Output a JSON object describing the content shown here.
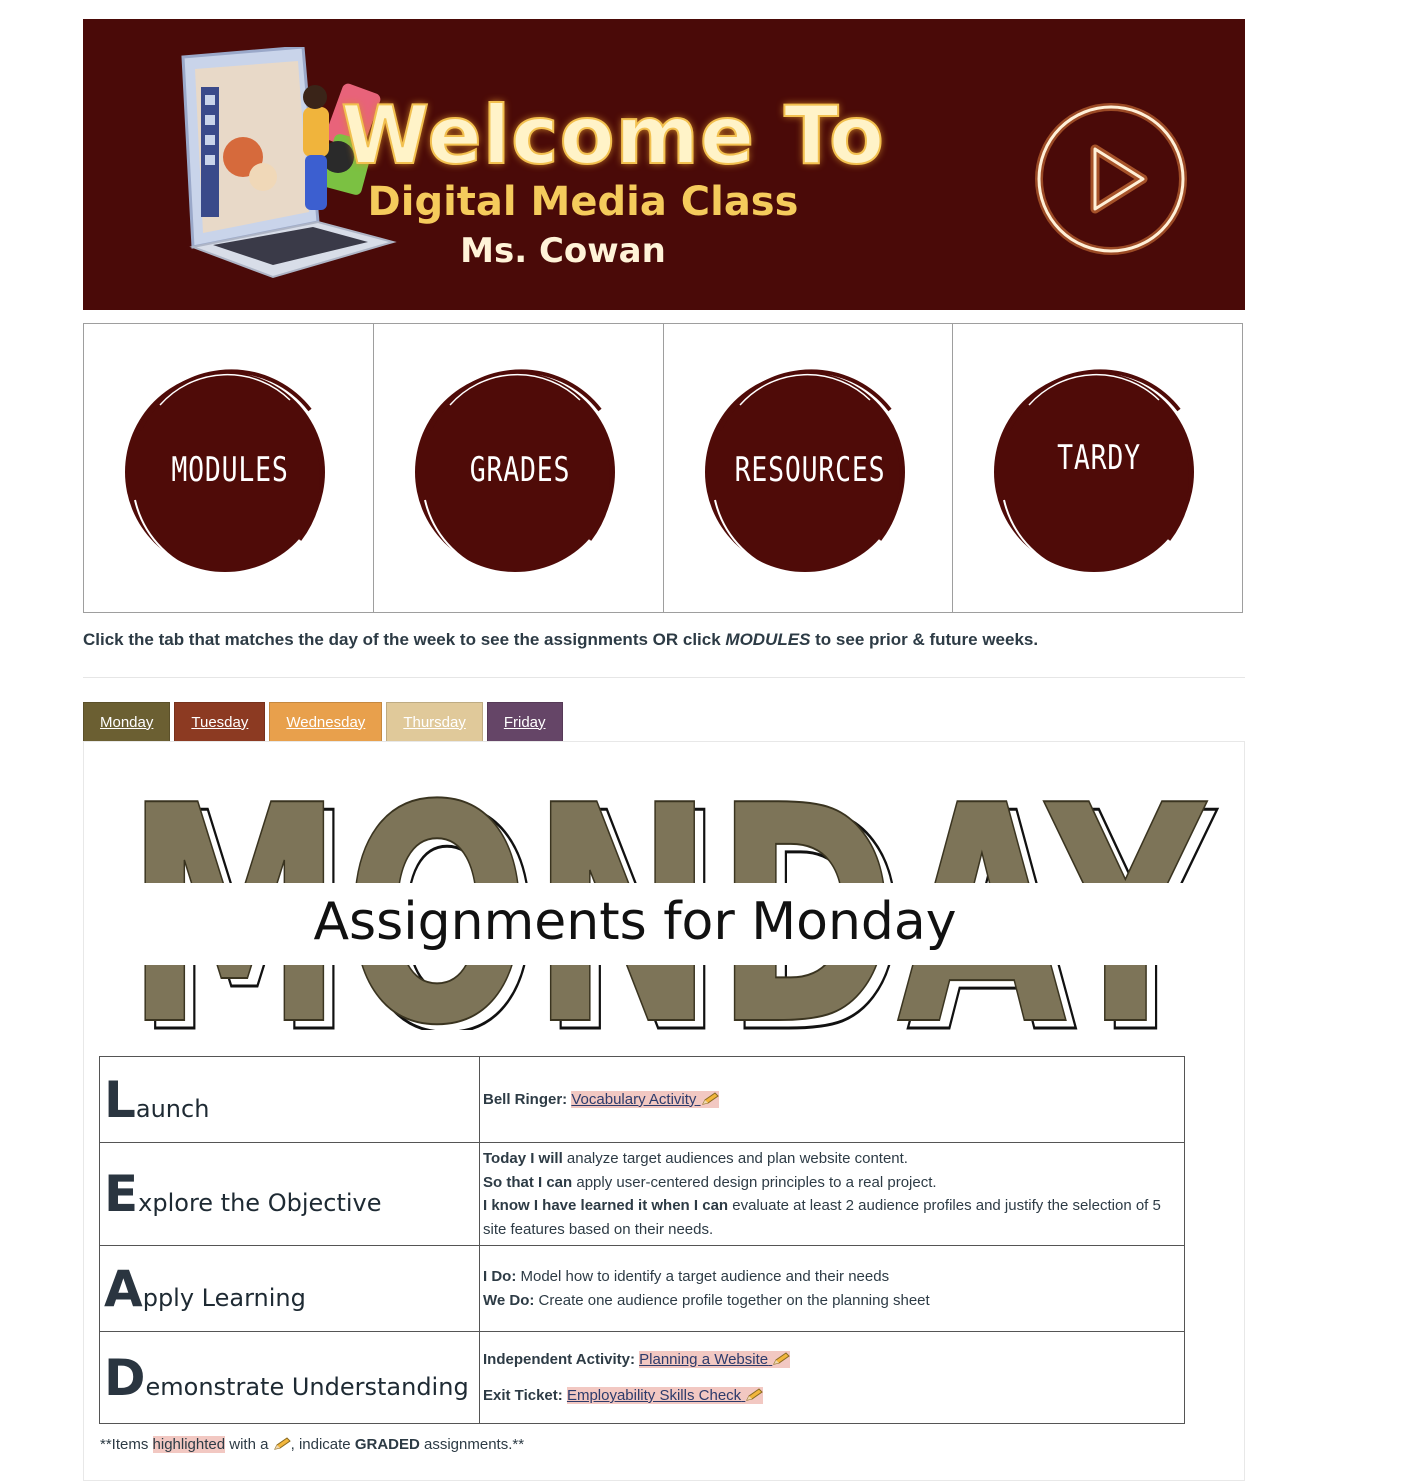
{
  "banner": {
    "title": "Welcome To",
    "class_name": "Digital Media Class",
    "teacher": "Ms. Cowan"
  },
  "nav": {
    "buttons": [
      "MODULES",
      "GRADES",
      "RESOURCES",
      "TARDY"
    ]
  },
  "instruction": {
    "part1": "Click the tab that matches the day of the week to see the assignments OR click ",
    "emphasis": "MODULES",
    "part2": " to see prior & future weeks."
  },
  "tabs": [
    {
      "label": "Monday",
      "bg": "#6b5f32",
      "color": "#ffffff"
    },
    {
      "label": "Tuesday",
      "bg": "#8c3a22",
      "color": "#ffffff"
    },
    {
      "label": "Wednesday",
      "bg": "#e8a04c",
      "color": "#ffffff"
    },
    {
      "label": "Thursday",
      "bg": "#e0c99a",
      "color": "#ffffff"
    },
    {
      "label": "Friday",
      "bg": "#654567",
      "color": "#ffffff"
    }
  ],
  "day_graphic": {
    "big_word": "MONDAY",
    "subtitle": "Assignments for Monday",
    "fill_color": "#7d7458"
  },
  "lead": {
    "launch": {
      "cap": "L",
      "rest": "aunch",
      "bell_label": "Bell Ringer:",
      "bell_link": "Vocabulary Activity"
    },
    "explore": {
      "cap": "E",
      "rest": "xplore the Objective",
      "l1_bold": "Today I will",
      "l1_text": " analyze target audiences and plan website content.",
      "l2_bold": "So that I can",
      "l2_text": " apply user-centered design principles to a real project.",
      "l3_bold": "I know I have learned it when I can",
      "l3_text": " evaluate at least 2 audience profiles and justify the selection of 5 site features based on their needs."
    },
    "apply": {
      "cap": "A",
      "rest": "pply Learning",
      "l1_bold": "I Do:",
      "l1_text": " Model how to identify a target audience and their needs",
      "l2_bold": "We Do:",
      "l2_text": " Create one audience profile together on the planning sheet"
    },
    "demonstrate": {
      "cap": "D",
      "rest": "emonstrate Understanding",
      "ind_label": "Independent Activity:",
      "ind_link": "Planning a Website",
      "exit_label": "Exit Ticket:",
      "exit_link": "Employability Skills Check"
    }
  },
  "footnote": {
    "p1": "**Items ",
    "mark": "highlighted",
    "p2": " with a ",
    "p3": ", indicate ",
    "bold": "GRADED",
    "p4": " assignments.**"
  }
}
